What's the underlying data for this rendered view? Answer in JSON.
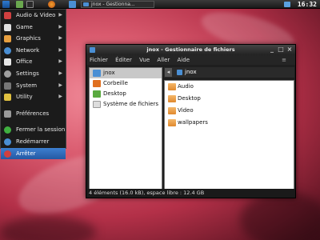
{
  "panel": {
    "task_label": "jnox - Gestionna...",
    "clock": "16:32",
    "icons": [
      "menu-icon",
      "files-icon",
      "terminal-icon",
      "firefox-icon",
      "desktop-icon"
    ]
  },
  "menu": {
    "items": [
      {
        "label": "Audio & Video",
        "icon": "audio-video-icon",
        "color": "#d04040",
        "submenu": true
      },
      {
        "label": "Game",
        "icon": "game-icon",
        "color": "#e0e0e0",
        "submenu": true
      },
      {
        "label": "Graphics",
        "icon": "graphics-icon",
        "color": "#e8a040",
        "submenu": true
      },
      {
        "label": "Network",
        "icon": "network-icon",
        "color": "#4a8fd4",
        "submenu": true
      },
      {
        "label": "Office",
        "icon": "office-icon",
        "color": "#e8e8e8",
        "submenu": true
      },
      {
        "label": "Settings",
        "icon": "settings-icon",
        "color": "#a0a0a0",
        "submenu": true
      },
      {
        "label": "System",
        "icon": "system-icon",
        "color": "#777777",
        "submenu": true
      },
      {
        "label": "Utility",
        "icon": "utility-icon",
        "color": "#e0c040",
        "submenu": true
      }
    ],
    "prefs": {
      "label": "Préférences",
      "icon": "wrench-icon",
      "color": "#9a9a9a"
    },
    "session": [
      {
        "label": "Fermer la session",
        "icon": "logout-icon",
        "color": "#40b040"
      },
      {
        "label": "Redémarrer",
        "icon": "restart-icon",
        "color": "#4a8fd4"
      },
      {
        "label": "Arrêter",
        "icon": "shutdown-icon",
        "color": "#d04040"
      }
    ]
  },
  "window": {
    "title": "jnox - Gestionnaire de fichiers",
    "minimize": "_",
    "maximize": "□",
    "close": "×",
    "menubar": [
      "Fichier",
      "Éditer",
      "Vue",
      "Aller",
      "Aide"
    ],
    "menubar_more": "≡",
    "sidebar": [
      {
        "label": "jnox",
        "icon": "home-folder-icon",
        "color": "#4a8fd4"
      },
      {
        "label": "Corbeille",
        "icon": "trash-icon",
        "color": "#e07020"
      },
      {
        "label": "Desktop",
        "icon": "desktop-folder-icon",
        "color": "#5aaa40"
      },
      {
        "label": "Système de fichiers",
        "icon": "filesystem-icon",
        "color": "#dddddd"
      }
    ],
    "path": {
      "back": "◂",
      "current": "jnox"
    },
    "files": [
      "Audio",
      "Desktop",
      "Video",
      "wallpapers"
    ],
    "status": "4 éléments (16.0 kB), espace libre : 12.4 GB"
  }
}
